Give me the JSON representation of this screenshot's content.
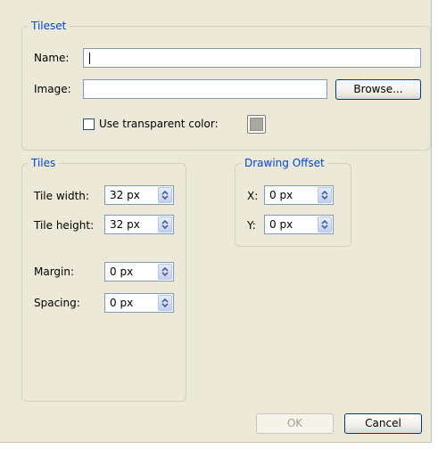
{
  "tileset": {
    "title": "Tileset",
    "name_label": "Name:",
    "name_value": "",
    "image_label": "Image:",
    "image_value": "",
    "browse_label": "Browse...",
    "transparent_label": "Use transparent color:",
    "transparent_checked": false,
    "transparent_color": "#a9a89f"
  },
  "tiles": {
    "title": "Tiles",
    "tile_width_label": "Tile width:",
    "tile_width_value": "32 px",
    "tile_height_label": "Tile height:",
    "tile_height_value": "32 px",
    "margin_label": "Margin:",
    "margin_value": "0 px",
    "spacing_label": "Spacing:",
    "spacing_value": "0 px"
  },
  "offset": {
    "title": "Drawing Offset",
    "x_label": "X:",
    "x_value": "0 px",
    "y_label": "Y:",
    "y_value": "0 px"
  },
  "buttons": {
    "ok_label": "OK",
    "ok_enabled": false,
    "cancel_label": "Cancel"
  },
  "icons": {
    "spin": "spin-arrows-icon"
  },
  "colors": {
    "dialog_background": "#ece9d8",
    "group_title": "#0046d5",
    "field_border": "#7f9db9"
  }
}
